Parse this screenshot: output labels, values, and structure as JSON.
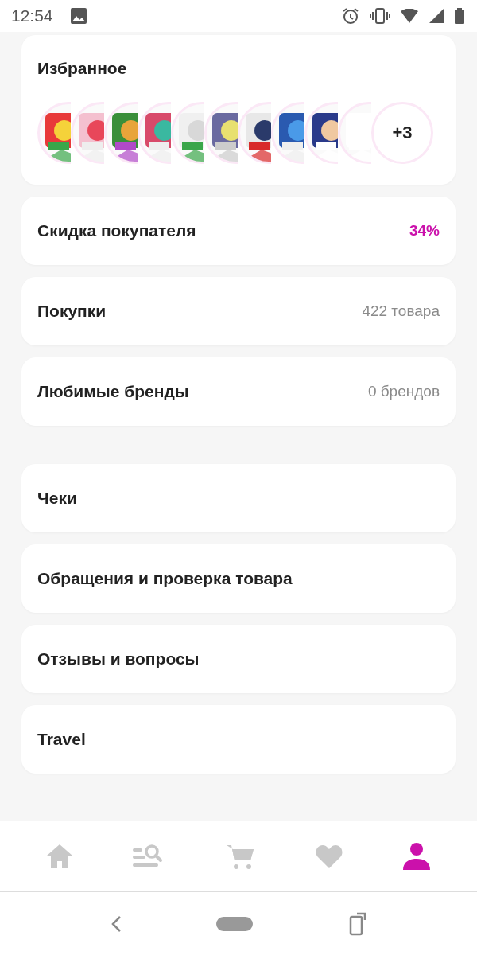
{
  "status_bar": {
    "time": "12:54"
  },
  "favorites": {
    "title": "Избранное",
    "more": "+3"
  },
  "groups": [
    [
      {
        "label": "Скидка покупателя",
        "value": "34%",
        "accent": true
      },
      {
        "label": "Покупки",
        "value": "422 товара",
        "accent": false
      },
      {
        "label": "Любимые бренды",
        "value": "0 брендов",
        "accent": false
      }
    ],
    [
      {
        "label": "Чеки"
      },
      {
        "label": "Обращения и проверка товара"
      },
      {
        "label": "Отзывы и вопросы"
      },
      {
        "label": "Travel"
      }
    ]
  ],
  "bottom_nav": [
    {
      "kind": "home",
      "selected": false
    },
    {
      "kind": "catalog",
      "selected": false
    },
    {
      "kind": "cart",
      "selected": false
    },
    {
      "kind": "favorites",
      "selected": false
    },
    {
      "kind": "profile",
      "selected": true
    }
  ]
}
